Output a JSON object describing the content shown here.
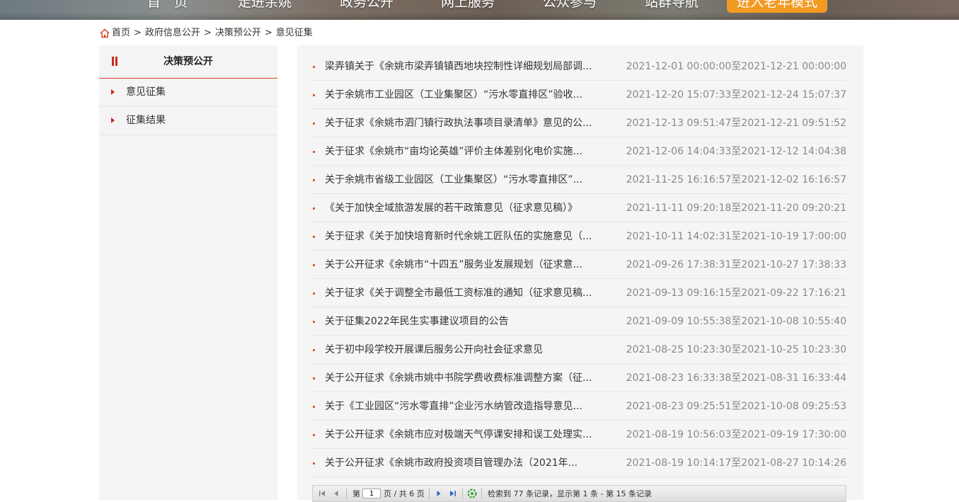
{
  "nav": {
    "items": [
      "首　页",
      "走进余姚",
      "政务公开",
      "网上服务",
      "公众参与",
      "站群导航"
    ],
    "elder_mode": "进入老年模式"
  },
  "breadcrumb": [
    "首页",
    "政府信息公开",
    "决策预公开",
    "意见征集"
  ],
  "breadcrumb_sep": ">",
  "sidebar": {
    "title": "决策预公开",
    "items": [
      "意见征集",
      "征集结果"
    ]
  },
  "list": [
    {
      "title": "梁弄镇关于《余姚市梁弄镇镇西地块控制性详细规划局部调...",
      "date": "2021-12-01 00:00:00至2021-12-21 00:00:00"
    },
    {
      "title": "关于余姚市工业园区（工业集聚区）“污水零直排区”验收...",
      "date": "2021-12-20 15:07:33至2021-12-24 15:07:37"
    },
    {
      "title": "关于征求《余姚市泗门镇行政执法事项目录清单》意见的公...",
      "date": "2021-12-13 09:51:47至2021-12-21 09:51:52"
    },
    {
      "title": "关于征求《余姚市“亩均论英雄”评价主体差别化电价实施...",
      "date": "2021-12-06 14:04:33至2021-12-12 14:04:38"
    },
    {
      "title": "关于余姚市省级工业园区（工业集聚区）“污水零直排区”...",
      "date": "2021-11-25 16:16:57至2021-12-02 16:16:57"
    },
    {
      "title": "《关于加快全域旅游发展的若干政策意见（征求意见稿）》",
      "date": "2021-11-11 09:20:18至2021-11-20 09:20:21"
    },
    {
      "title": "关于征求《关于加快培育新时代余姚工匠队伍的实施意见（...",
      "date": "2021-10-11 14:02:31至2021-10-19 17:00:00"
    },
    {
      "title": "关于公开征求《余姚市“十四五”服务业发展规划（征求意...",
      "date": "2021-09-26 17:38:31至2021-10-27 17:38:33"
    },
    {
      "title": "关于征求《关于调整全市最低工资标准的通知（征求意见稿...",
      "date": "2021-09-13 09:16:15至2021-09-22 17:16:21"
    },
    {
      "title": "关于征集2022年民生实事建议项目的公告",
      "date": "2021-09-09 10:55:38至2021-10-08 10:55:40"
    },
    {
      "title": "关于初中段学校开展课后服务公开向社会征求意见",
      "date": "2021-08-25 10:23:30至2021-10-25 10:23:30"
    },
    {
      "title": "关于公开征求《余姚市姚中书院学费收费标准调整方案（征...",
      "date": "2021-08-23 16:33:38至2021-08-31 16:33:44"
    },
    {
      "title": "关于《工业园区“污水零直排”企业污水纳管改造指导意见...",
      "date": "2021-08-23 09:25:51至2021-10-08 09:25:53"
    },
    {
      "title": "关于公开征求《余姚市应对极端天气停课安排和误工处理实...",
      "date": "2021-08-19 10:56:03至2021-09-19 17:30:00"
    },
    {
      "title": "关于公开征求《余姚市政府投资项目管理办法（2021年...",
      "date": "2021-08-19 10:14:17至2021-08-27 10:14:26"
    }
  ],
  "pager": {
    "page_prefix": "第",
    "current_page": "1",
    "page_suffix": "页 / 共 6 页",
    "summary": "检索到 77 条记录，显示第 1 条 - 第 15 条记录"
  },
  "colors": {
    "accent_red": "#c8291e",
    "elder_orange": "#f29a22",
    "bullet": "#e05a2a"
  },
  "icons": {
    "home": "home-icon",
    "first": "first-page-icon",
    "prev": "prev-page-icon",
    "next": "next-page-icon",
    "last": "last-page-icon",
    "refresh": "refresh-icon"
  }
}
